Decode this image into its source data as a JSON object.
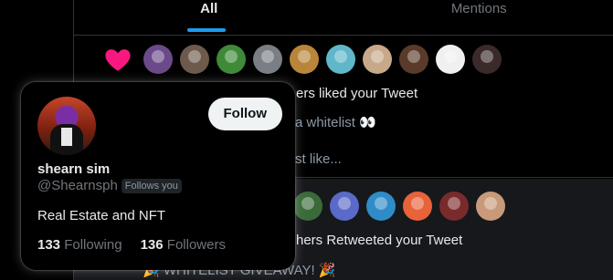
{
  "tabs": [
    {
      "label": "All"
    },
    {
      "label": "Mentions"
    }
  ],
  "likes_notification": {
    "icon": "heart-icon",
    "icon_color": "#f91880",
    "avatars": [
      {
        "color": "#6b4a8a"
      },
      {
        "color": "#6e5a4c"
      },
      {
        "color": "#3f8a38"
      },
      {
        "color": "#7a7f85"
      },
      {
        "color": "#b8853a"
      },
      {
        "color": "#5fb7c9"
      },
      {
        "color": "#c8a88a"
      },
      {
        "color": "#5a3a2a"
      },
      {
        "color": "#f0f0f0"
      },
      {
        "color": "#3b2a2a"
      }
    ],
    "title_fragment": "ers liked your Tweet",
    "line2_fragment": "a whitelist 👀",
    "line3_fragment": "st like..."
  },
  "retweets_notification": {
    "avatars": [
      {
        "color": "#3a6a3a"
      },
      {
        "color": "#5a6ac8"
      },
      {
        "color": "#2f8cc8"
      },
      {
        "color": "#e8623a"
      },
      {
        "color": "#7a2a2a"
      },
      {
        "color": "#c89a7a"
      }
    ],
    "title_fragment": "hers Retweeted your Tweet",
    "line2": "🎉 WHITELIST GIVEAWAY! 🎉"
  },
  "hover_card": {
    "display_name": "shearn sim",
    "handle": "@Shearnsph",
    "follows_you_label": "Follows you",
    "follow_button": "Follow",
    "bio": "Real Estate and NFT",
    "following_count": "133",
    "following_label": "Following",
    "followers_count": "136",
    "followers_label": "Followers"
  },
  "colors": {
    "accent": "#1d9bf0",
    "background": "#000000",
    "border": "#2f3336"
  }
}
